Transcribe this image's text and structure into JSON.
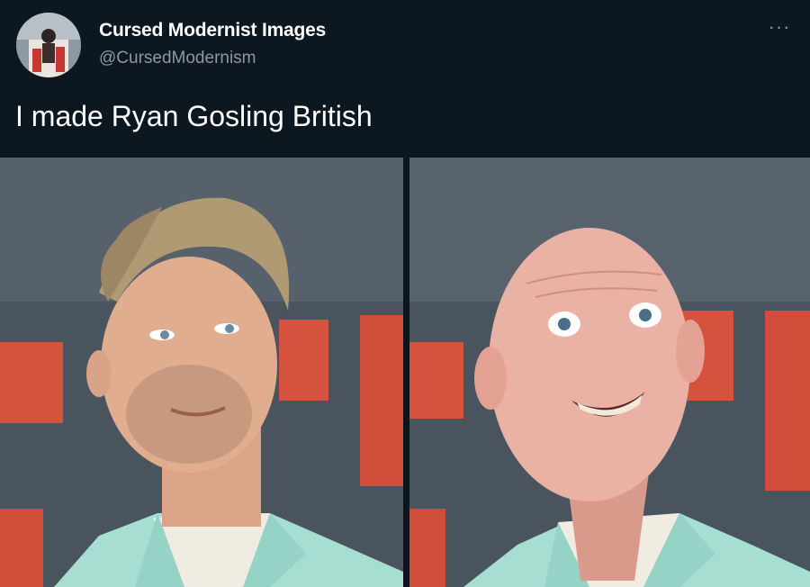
{
  "tweet": {
    "display_name": "Cursed Modernist Images",
    "handle": "@CursedModernism",
    "text": "I made Ryan Gosling British",
    "more_icon": "ellipsis-icon"
  },
  "media": [
    {
      "description_icon": "photo"
    },
    {
      "description_icon": "photo"
    }
  ],
  "colors": {
    "background": "#0c1720",
    "name": "#ffffff",
    "handle": "#8b98a5",
    "backdrop_gray": "#4b5560",
    "backdrop_red": "#d2513f",
    "jacket": "#a9dfd4"
  }
}
